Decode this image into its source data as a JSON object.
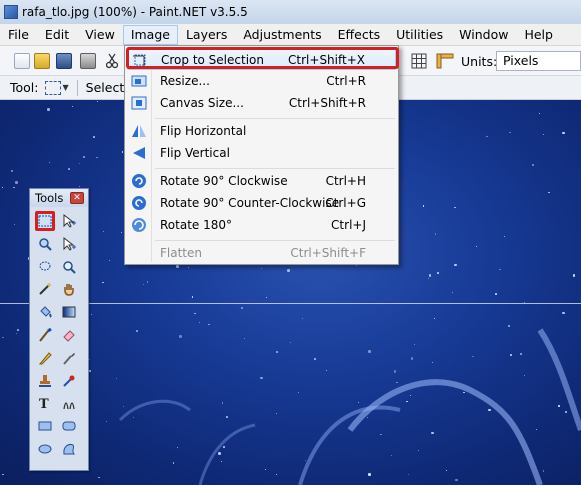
{
  "window": {
    "title": "rafa_tlo.jpg (100%) - Paint.NET v3.5.5"
  },
  "menubar": {
    "items": [
      "File",
      "Edit",
      "View",
      "Image",
      "Layers",
      "Adjustments",
      "Effects",
      "Utilities",
      "Window",
      "Help"
    ],
    "active": "Image"
  },
  "toolbar": {
    "units_label": "Units:",
    "units_value": "Pixels"
  },
  "toolbar2": {
    "tool_label": "Tool:",
    "selection_label": "Selectio"
  },
  "image_menu": {
    "items": [
      {
        "label": "Crop to Selection",
        "shortcut": "Ctrl+Shift+X",
        "icon": "crop-icon",
        "highlighted": true
      },
      {
        "label": "Resize...",
        "shortcut": "Ctrl+R",
        "icon": "resize-icon"
      },
      {
        "label": "Canvas Size...",
        "shortcut": "Ctrl+Shift+R",
        "icon": "canvas-size-icon"
      },
      {
        "label": "Flip Horizontal",
        "shortcut": "",
        "icon": "flip-horizontal-icon"
      },
      {
        "label": "Flip Vertical",
        "shortcut": "",
        "icon": "flip-vertical-icon"
      },
      {
        "label": "Rotate 90° Clockwise",
        "shortcut": "Ctrl+H",
        "icon": "rotate-cw-icon"
      },
      {
        "label": "Rotate 90° Counter-Clockwise",
        "shortcut": "Ctrl+G",
        "icon": "rotate-ccw-icon"
      },
      {
        "label": "Rotate 180°",
        "shortcut": "Ctrl+J",
        "icon": "rotate-180-icon"
      },
      {
        "label": "Flatten",
        "shortcut": "Ctrl+Shift+F",
        "icon": "flatten-icon",
        "disabled": true
      }
    ]
  },
  "tools_window": {
    "title": "Tools",
    "tools": [
      "rectangle-select-icon",
      "move-selection-icon",
      "zoom-icon",
      "move-selected-icon",
      "lasso-select-icon",
      "magnifier-icon",
      "magic-wand-icon",
      "pan-hand-icon",
      "paint-bucket-icon",
      "gradient-icon",
      "paintbrush-icon",
      "eraser-icon",
      "pencil-icon",
      "color-picker-icon",
      "clone-stamp-icon",
      "recolor-icon",
      "text-icon",
      "line-curve-icon",
      "rectangle-icon",
      "rounded-rectangle-icon",
      "ellipse-icon",
      "freeform-shape-icon"
    ],
    "selected": "rectangle-select-icon"
  },
  "colors": {
    "highlight_red": "#d42020",
    "canvas_blue": "#183c98",
    "menu_bg": "#f5f5f5"
  }
}
